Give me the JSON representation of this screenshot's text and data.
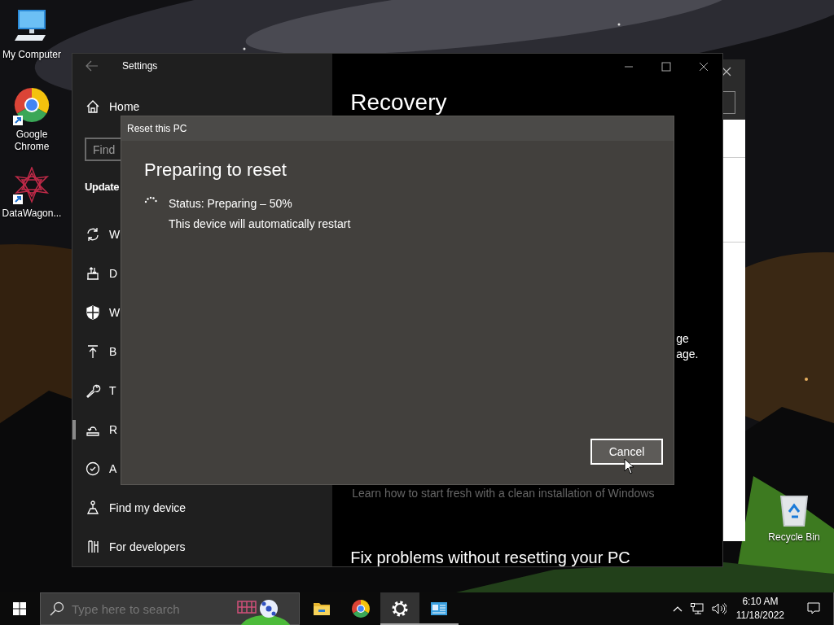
{
  "desktop": {
    "icons": [
      {
        "kind": "computer",
        "label": "My Computer",
        "shortcut": false
      },
      {
        "kind": "browser",
        "label": "Google Chrome",
        "shortcut": true
      },
      {
        "kind": "app",
        "label": "DataWagon...",
        "shortcut": true
      },
      {
        "kind": "trash",
        "label": "Recycle Bin",
        "shortcut": false
      }
    ]
  },
  "settings": {
    "title": "Settings",
    "home": "Home",
    "search": {
      "placeholder": "Find"
    },
    "section": "Update",
    "items": [
      {
        "kind": "sync",
        "label": "W",
        "selected": false
      },
      {
        "kind": "delivery",
        "label": "D",
        "selected": false
      },
      {
        "kind": "shield",
        "label": "W",
        "selected": false
      },
      {
        "kind": "backup",
        "label": "B",
        "selected": false
      },
      {
        "kind": "wrench",
        "label": "T",
        "selected": false
      },
      {
        "kind": "recovery",
        "label": "R",
        "selected": true
      },
      {
        "kind": "check",
        "label": "A",
        "selected": false
      },
      {
        "kind": "find",
        "label": "Find my device",
        "selected": false
      },
      {
        "kind": "developer",
        "label": "For developers",
        "selected": false
      }
    ],
    "page": {
      "heading": "Recovery",
      "fragments": [
        "ge",
        "age."
      ],
      "link": "Learn how to start fresh with a clean installation of Windows",
      "subheading": "Fix problems without resetting your PC"
    }
  },
  "dialog": {
    "title": "Reset this PC",
    "heading": "Preparing to reset",
    "status": "Status: Preparing – 50%",
    "note": "This device will automatically restart",
    "button": "Cancel"
  },
  "taskbar": {
    "search": {
      "placeholder": "Type here to search"
    },
    "apps": [
      {
        "kind": "folder",
        "running": false,
        "active": false
      },
      {
        "kind": "browser",
        "running": false,
        "active": false
      },
      {
        "kind": "gear",
        "running": true,
        "active": true
      },
      {
        "kind": "app",
        "running": true,
        "active": false
      }
    ],
    "clock": {
      "time": "6:10 AM",
      "date": "11/18/2022"
    }
  }
}
